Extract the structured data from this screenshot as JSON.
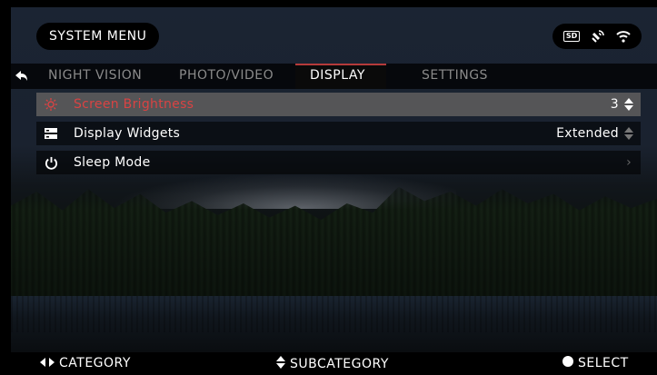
{
  "header": {
    "title": "SYSTEM MENU"
  },
  "status": {
    "sd_label": "SD",
    "icons": [
      "sd-card-icon",
      "gps-icon",
      "wifi-icon"
    ]
  },
  "tabs": [
    {
      "label": "NIGHT VISION",
      "active": false
    },
    {
      "label": "PHOTO/VIDEO",
      "active": false
    },
    {
      "label": "DISPLAY",
      "active": true
    },
    {
      "label": "SETTINGS",
      "active": false
    }
  ],
  "menu": {
    "items": [
      {
        "label": "Screen Brightness",
        "value": "3",
        "icon": "brightness-icon",
        "selected": true
      },
      {
        "label": "Display Widgets",
        "value": "Extended",
        "icon": "widgets-icon",
        "selected": false
      },
      {
        "label": "Sleep Mode",
        "value": "",
        "icon": "power-icon",
        "selected": false
      }
    ]
  },
  "footer": {
    "category": "CATEGORY",
    "subcategory": "SUBCATEGORY",
    "select": "SELECT"
  },
  "colors": {
    "accent": "#d94343",
    "selected_row": "#555557",
    "tab_indicator": "#b53a3a"
  }
}
